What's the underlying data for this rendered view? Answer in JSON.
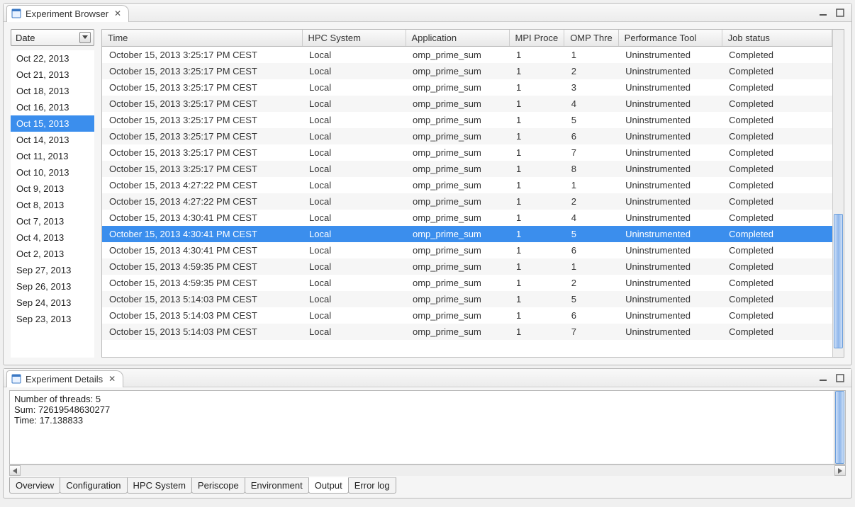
{
  "top_panel": {
    "title": "Experiment Browser",
    "filter": {
      "label": "Date",
      "dates": [
        "Oct 22, 2013",
        "Oct 21, 2013",
        "Oct 18, 2013",
        "Oct 16, 2013",
        "Oct 15, 2013",
        "Oct 14, 2013",
        "Oct 11, 2013",
        "Oct 10, 2013",
        "Oct 9, 2013",
        "Oct 8, 2013",
        "Oct 7, 2013",
        "Oct 4, 2013",
        "Oct 2, 2013",
        "Sep 27, 2013",
        "Sep 26, 2013",
        "Sep 24, 2013",
        "Sep 23, 2013"
      ],
      "selected_index": 4
    },
    "table": {
      "columns": [
        "Time",
        "HPC System",
        "Application",
        "MPI Proce",
        "OMP Thre",
        "Performance Tool",
        "Job status"
      ],
      "rows": [
        {
          "time": "October 15, 2013 3:25:17 PM CEST",
          "hpc": "Local",
          "app": "omp_prime_sum",
          "mpi": "1",
          "omp": "1",
          "tool": "Uninstrumented",
          "status": "Completed"
        },
        {
          "time": "October 15, 2013 3:25:17 PM CEST",
          "hpc": "Local",
          "app": "omp_prime_sum",
          "mpi": "1",
          "omp": "2",
          "tool": "Uninstrumented",
          "status": "Completed"
        },
        {
          "time": "October 15, 2013 3:25:17 PM CEST",
          "hpc": "Local",
          "app": "omp_prime_sum",
          "mpi": "1",
          "omp": "3",
          "tool": "Uninstrumented",
          "status": "Completed"
        },
        {
          "time": "October 15, 2013 3:25:17 PM CEST",
          "hpc": "Local",
          "app": "omp_prime_sum",
          "mpi": "1",
          "omp": "4",
          "tool": "Uninstrumented",
          "status": "Completed"
        },
        {
          "time": "October 15, 2013 3:25:17 PM CEST",
          "hpc": "Local",
          "app": "omp_prime_sum",
          "mpi": "1",
          "omp": "5",
          "tool": "Uninstrumented",
          "status": "Completed"
        },
        {
          "time": "October 15, 2013 3:25:17 PM CEST",
          "hpc": "Local",
          "app": "omp_prime_sum",
          "mpi": "1",
          "omp": "6",
          "tool": "Uninstrumented",
          "status": "Completed"
        },
        {
          "time": "October 15, 2013 3:25:17 PM CEST",
          "hpc": "Local",
          "app": "omp_prime_sum",
          "mpi": "1",
          "omp": "7",
          "tool": "Uninstrumented",
          "status": "Completed"
        },
        {
          "time": "October 15, 2013 3:25:17 PM CEST",
          "hpc": "Local",
          "app": "omp_prime_sum",
          "mpi": "1",
          "omp": "8",
          "tool": "Uninstrumented",
          "status": "Completed"
        },
        {
          "time": "October 15, 2013 4:27:22 PM CEST",
          "hpc": "Local",
          "app": "omp_prime_sum",
          "mpi": "1",
          "omp": "1",
          "tool": "Uninstrumented",
          "status": "Completed"
        },
        {
          "time": "October 15, 2013 4:27:22 PM CEST",
          "hpc": "Local",
          "app": "omp_prime_sum",
          "mpi": "1",
          "omp": "2",
          "tool": "Uninstrumented",
          "status": "Completed"
        },
        {
          "time": "October 15, 2013 4:30:41 PM CEST",
          "hpc": "Local",
          "app": "omp_prime_sum",
          "mpi": "1",
          "omp": "4",
          "tool": "Uninstrumented",
          "status": "Completed"
        },
        {
          "time": "October 15, 2013 4:30:41 PM CEST",
          "hpc": "Local",
          "app": "omp_prime_sum",
          "mpi": "1",
          "omp": "5",
          "tool": "Uninstrumented",
          "status": "Completed"
        },
        {
          "time": "October 15, 2013 4:30:41 PM CEST",
          "hpc": "Local",
          "app": "omp_prime_sum",
          "mpi": "1",
          "omp": "6",
          "tool": "Uninstrumented",
          "status": "Completed"
        },
        {
          "time": "October 15, 2013 4:59:35 PM CEST",
          "hpc": "Local",
          "app": "omp_prime_sum",
          "mpi": "1",
          "omp": "1",
          "tool": "Uninstrumented",
          "status": "Completed"
        },
        {
          "time": "October 15, 2013 4:59:35 PM CEST",
          "hpc": "Local",
          "app": "omp_prime_sum",
          "mpi": "1",
          "omp": "2",
          "tool": "Uninstrumented",
          "status": "Completed"
        },
        {
          "time": "October 15, 2013 5:14:03 PM CEST",
          "hpc": "Local",
          "app": "omp_prime_sum",
          "mpi": "1",
          "omp": "5",
          "tool": "Uninstrumented",
          "status": "Completed"
        },
        {
          "time": "October 15, 2013 5:14:03 PM CEST",
          "hpc": "Local",
          "app": "omp_prime_sum",
          "mpi": "1",
          "omp": "6",
          "tool": "Uninstrumented",
          "status": "Completed"
        },
        {
          "time": "October 15, 2013 5:14:03 PM CEST",
          "hpc": "Local",
          "app": "omp_prime_sum",
          "mpi": "1",
          "omp": "7",
          "tool": "Uninstrumented",
          "status": "Completed"
        }
      ],
      "selected_row_index": 11
    }
  },
  "bottom_panel": {
    "title": "Experiment Details",
    "output_text": "Number of threads: 5\nSum: 72619548630277\nTime: 17.138833",
    "tabs": [
      "Overview",
      "Configuration",
      "HPC System",
      "Periscope",
      "Environment",
      "Output",
      "Error log"
    ],
    "active_tab_index": 5
  },
  "icons": {
    "close": "✕"
  }
}
